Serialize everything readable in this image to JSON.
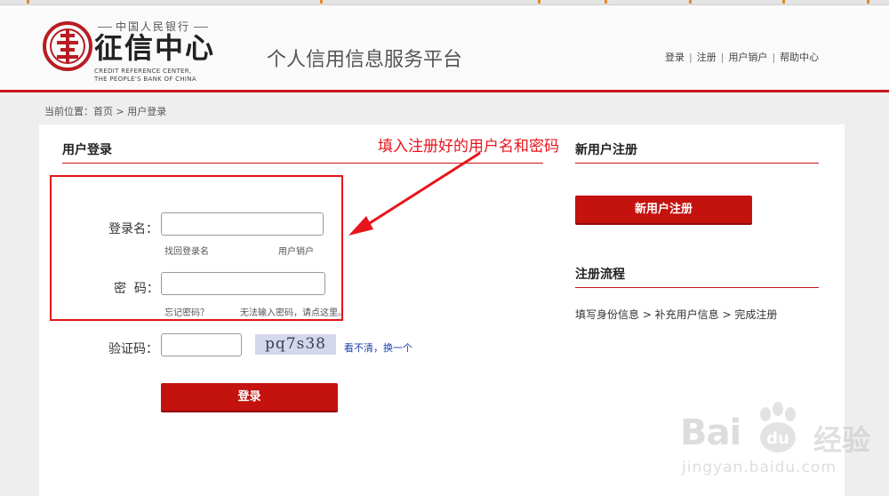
{
  "header": {
    "logo_top": "中国人民银行",
    "logo_main": "征信中心",
    "logo_en_line1": "CREDIT REFERENCE CENTER,",
    "logo_en_line2": "THE PEOPLE'S BANK OF CHINA",
    "platform_title": "个人信用信息服务平台",
    "nav": [
      "登录",
      "注册",
      "用户销户",
      "帮助中心"
    ],
    "nav_separator": "|"
  },
  "breadcrumb": "当前位置：首页 > 用户登录",
  "login": {
    "title": "用户登录",
    "username_label": "登录名：",
    "username_value": "",
    "recover_username": "找回登录名",
    "user_cancel": "用户销户",
    "password_label": "密  码：",
    "password_value": "",
    "forgot_password": "忘记密码？",
    "cannot_input_password": "无法输入密码，请点这里。",
    "captcha_label": "验证码：",
    "captcha_value": "",
    "captcha_image_text": "pq7s38",
    "captcha_refresh": "看不清，换一个",
    "login_button": "登录"
  },
  "register": {
    "title": "新用户注册",
    "button": "新用户注册",
    "process_title": "注册流程",
    "process_steps": "填写身份信息 > 补充用户信息 > 完成注册"
  },
  "annotation": {
    "text": "填入注册好的用户名和密码"
  },
  "watermark": {
    "brand": "Bai",
    "brand_suffix": "du",
    "cn": "经验",
    "url": "jingyan.baidu.com"
  },
  "colors": {
    "brand_red": "#c8161e",
    "button_red": "#c4120f",
    "annotation_red": "#e8141b",
    "link_blue": "#1a3fa8"
  }
}
